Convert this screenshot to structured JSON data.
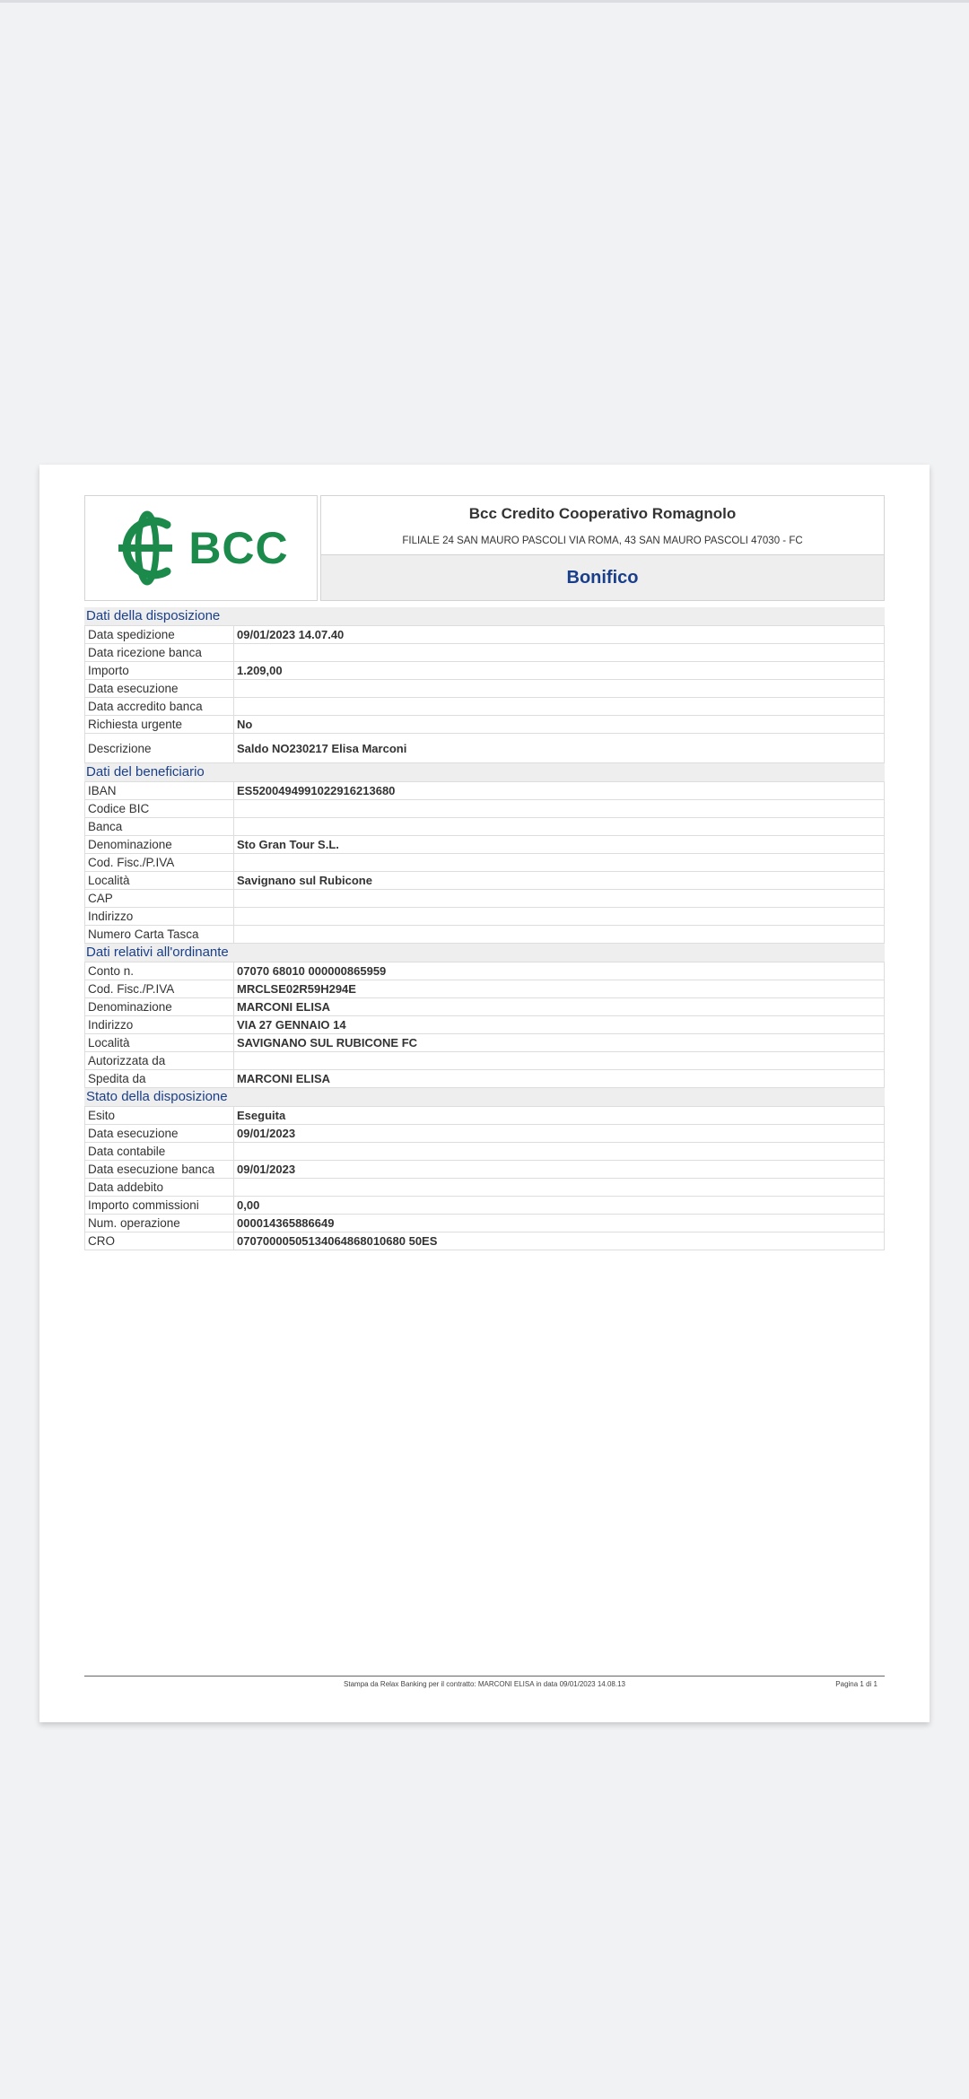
{
  "bank": {
    "logo_text": "BCC",
    "name": "Bcc Credito Cooperativo Romagnolo",
    "address": "FILIALE 24 SAN MAURO PASCOLI VIA ROMA, 43 SAN MAURO PASCOLI 47030 - FC",
    "brand_color": "#1b8a4a"
  },
  "document": {
    "type": "Bonifico",
    "title_color": "#1a3f8a"
  },
  "sections": [
    {
      "title": "Dati della disposizione",
      "rows": [
        {
          "label": "Data spedizione",
          "value": "09/01/2023 14.07.40"
        },
        {
          "label": "Data ricezione banca",
          "value": ""
        },
        {
          "label": "Importo",
          "value": "1.209,00"
        },
        {
          "label": "Data esecuzione",
          "value": ""
        },
        {
          "label": "Data accredito banca",
          "value": ""
        },
        {
          "label": "Richiesta urgente",
          "value": "No"
        },
        {
          "label": "Descrizione",
          "value": "Saldo NO230217 Elisa Marconi"
        }
      ]
    },
    {
      "title": "Dati del beneficiario",
      "rows": [
        {
          "label": "IBAN",
          "value": "ES5200494991022916213680"
        },
        {
          "label": "Codice BIC",
          "value": ""
        },
        {
          "label": "Banca",
          "value": ""
        },
        {
          "label": "Denominazione",
          "value": "Sto Gran Tour S.L."
        },
        {
          "label": "Cod. Fisc./P.IVA",
          "value": ""
        },
        {
          "label": "Località",
          "value": "Savignano sul Rubicone"
        },
        {
          "label": "CAP",
          "value": ""
        },
        {
          "label": "Indirizzo",
          "value": ""
        },
        {
          "label": "Numero Carta Tasca",
          "value": ""
        }
      ]
    },
    {
      "title": "Dati relativi all'ordinante",
      "rows": [
        {
          "label": "Conto n.",
          "value": "07070 68010 000000865959"
        },
        {
          "label": "Cod. Fisc./P.IVA",
          "value": "MRCLSE02R59H294E"
        },
        {
          "label": "Denominazione",
          "value": "MARCONI ELISA"
        },
        {
          "label": "Indirizzo",
          "value": "VIA 27 GENNAIO 14"
        },
        {
          "label": "Località",
          "value": "SAVIGNANO SUL RUBICONE FC"
        },
        {
          "label": "Autorizzata da",
          "value": ""
        },
        {
          "label": "Spedita da",
          "value": "MARCONI ELISA"
        }
      ]
    },
    {
      "title": "Stato della disposizione",
      "rows": [
        {
          "label": "Esito",
          "value": "Eseguita"
        },
        {
          "label": "Data esecuzione",
          "value": "09/01/2023"
        },
        {
          "label": "Data contabile",
          "value": ""
        },
        {
          "label": "Data esecuzione banca",
          "value": "09/01/2023"
        },
        {
          "label": "Data addebito",
          "value": ""
        },
        {
          "label": "Importo commissioni",
          "value": "0,00"
        },
        {
          "label": "Num. operazione",
          "value": "000014365886649"
        },
        {
          "label": "CRO",
          "value": "07070000505134064868010680 50ES"
        }
      ]
    }
  ],
  "footer": {
    "note": "Stampa da Relax Banking per il contratto: MARCONI ELISA in data 09/01/2023 14.08.13",
    "page": "Pagina 1 di   1"
  }
}
